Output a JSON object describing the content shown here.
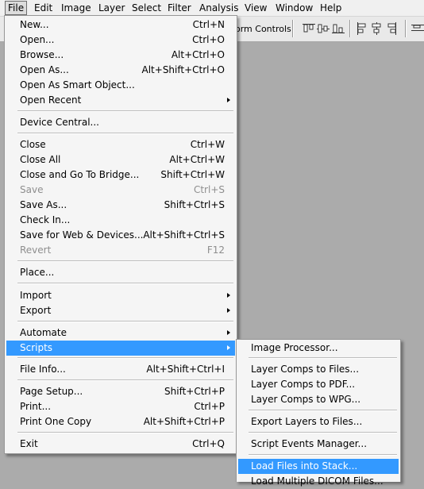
{
  "menubar": [
    {
      "label": "File",
      "active": true
    },
    {
      "label": "Edit"
    },
    {
      "label": "Image"
    },
    {
      "label": "Layer"
    },
    {
      "label": "Select"
    },
    {
      "label": "Filter"
    },
    {
      "label": "Analysis"
    },
    {
      "label": "View"
    },
    {
      "label": "Window"
    },
    {
      "label": "Help"
    }
  ],
  "options_bar": {
    "transform_controls_label": "orm Controls"
  },
  "file_menu": {
    "items": {
      "new": {
        "label": "New...",
        "shortcut": "Ctrl+N"
      },
      "open": {
        "label": "Open...",
        "shortcut": "Ctrl+O"
      },
      "browse": {
        "label": "Browse...",
        "shortcut": "Alt+Ctrl+O"
      },
      "open_as": {
        "label": "Open As...",
        "shortcut": "Alt+Shift+Ctrl+O"
      },
      "open_smart": {
        "label": "Open As Smart Object..."
      },
      "open_recent": {
        "label": "Open Recent"
      },
      "device_central": {
        "label": "Device Central..."
      },
      "close": {
        "label": "Close",
        "shortcut": "Ctrl+W"
      },
      "close_all": {
        "label": "Close All",
        "shortcut": "Alt+Ctrl+W"
      },
      "close_bridge": {
        "label": "Close and Go To Bridge...",
        "shortcut": "Shift+Ctrl+W"
      },
      "save": {
        "label": "Save",
        "shortcut": "Ctrl+S"
      },
      "save_as": {
        "label": "Save As...",
        "shortcut": "Shift+Ctrl+S"
      },
      "check_in": {
        "label": "Check In..."
      },
      "save_web": {
        "label": "Save for Web & Devices...",
        "shortcut": "Alt+Shift+Ctrl+S"
      },
      "revert": {
        "label": "Revert",
        "shortcut": "F12"
      },
      "place": {
        "label": "Place..."
      },
      "import": {
        "label": "Import"
      },
      "export": {
        "label": "Export"
      },
      "automate": {
        "label": "Automate"
      },
      "scripts": {
        "label": "Scripts"
      },
      "file_info": {
        "label": "File Info...",
        "shortcut": "Alt+Shift+Ctrl+I"
      },
      "page_setup": {
        "label": "Page Setup...",
        "shortcut": "Shift+Ctrl+P"
      },
      "print": {
        "label": "Print...",
        "shortcut": "Ctrl+P"
      },
      "print_one": {
        "label": "Print One Copy",
        "shortcut": "Alt+Shift+Ctrl+P"
      },
      "exit": {
        "label": "Exit",
        "shortcut": "Ctrl+Q"
      }
    }
  },
  "scripts_submenu": {
    "items": {
      "image_processor": {
        "label": "Image Processor..."
      },
      "layer_comps_files": {
        "label": "Layer Comps to Files..."
      },
      "layer_comps_pdf": {
        "label": "Layer Comps to PDF..."
      },
      "layer_comps_wpg": {
        "label": "Layer Comps to WPG..."
      },
      "export_layers": {
        "label": "Export Layers to Files..."
      },
      "script_events": {
        "label": "Script Events Manager..."
      },
      "load_stack": {
        "label": "Load Files into Stack..."
      },
      "load_dicom": {
        "label": "Load Multiple DICOM Files..."
      }
    }
  },
  "colors": {
    "highlight": "#3399ff",
    "menu_bg": "#f5f5f5",
    "workspace_bg": "#ababab"
  }
}
